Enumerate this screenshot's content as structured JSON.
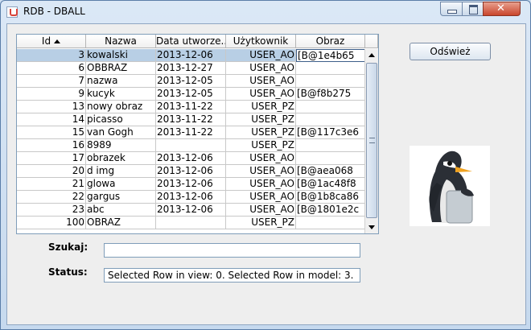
{
  "window": {
    "title": "RDB - DBALL"
  },
  "table": {
    "columns": [
      "Id",
      "Nazwa",
      "Data utworze...",
      "Użytkownik",
      "Obraz"
    ],
    "sort_column": "Id",
    "sort_direction": "ascending",
    "selected_row": 0,
    "rows": [
      [
        "3",
        "kowalski",
        "2013-12-06",
        "USER_AO",
        "[B@1e4b65"
      ],
      [
        "6",
        "OBBRAZ",
        "2013-12-27",
        "USER_AO",
        ""
      ],
      [
        "7",
        "nazwa",
        "2013-12-05",
        "USER_AO",
        ""
      ],
      [
        "9",
        "kucyk",
        "2013-12-05",
        "USER_AO",
        "[B@f8b275"
      ],
      [
        "13",
        "nowy obraz",
        "2013-11-22",
        "USER_PZ",
        ""
      ],
      [
        "14",
        "picasso",
        "2013-11-22",
        "USER_PZ",
        ""
      ],
      [
        "15",
        "van Gogh",
        "2013-11-22",
        "USER_PZ",
        "[B@117c3e6"
      ],
      [
        "16",
        "8989",
        "",
        "USER_PZ",
        ""
      ],
      [
        "17",
        "obrazek",
        "2013-12-06",
        "USER_AO",
        ""
      ],
      [
        "20",
        "d img",
        "2013-12-06",
        "USER_AO",
        "[B@aea068"
      ],
      [
        "21",
        "glowa",
        "2013-12-06",
        "USER_AO",
        "[B@1ac48f8"
      ],
      [
        "22",
        "gargus",
        "2013-12-06",
        "USER_AO",
        "[B@1b8ca86"
      ],
      [
        "23",
        "abc",
        "2013-12-06",
        "USER_AO",
        "[B@1801e2c"
      ],
      [
        "100",
        "OBRAZ",
        "",
        "USER_PZ",
        ""
      ]
    ]
  },
  "search": {
    "label": "Szukaj:",
    "value": ""
  },
  "status": {
    "label": "Status:",
    "value": "Selected Row in view: 0. Selected Row in model: 3."
  },
  "refresh_button": {
    "label": "Odśwież"
  },
  "image_preview": {
    "subject": "penguin"
  }
}
